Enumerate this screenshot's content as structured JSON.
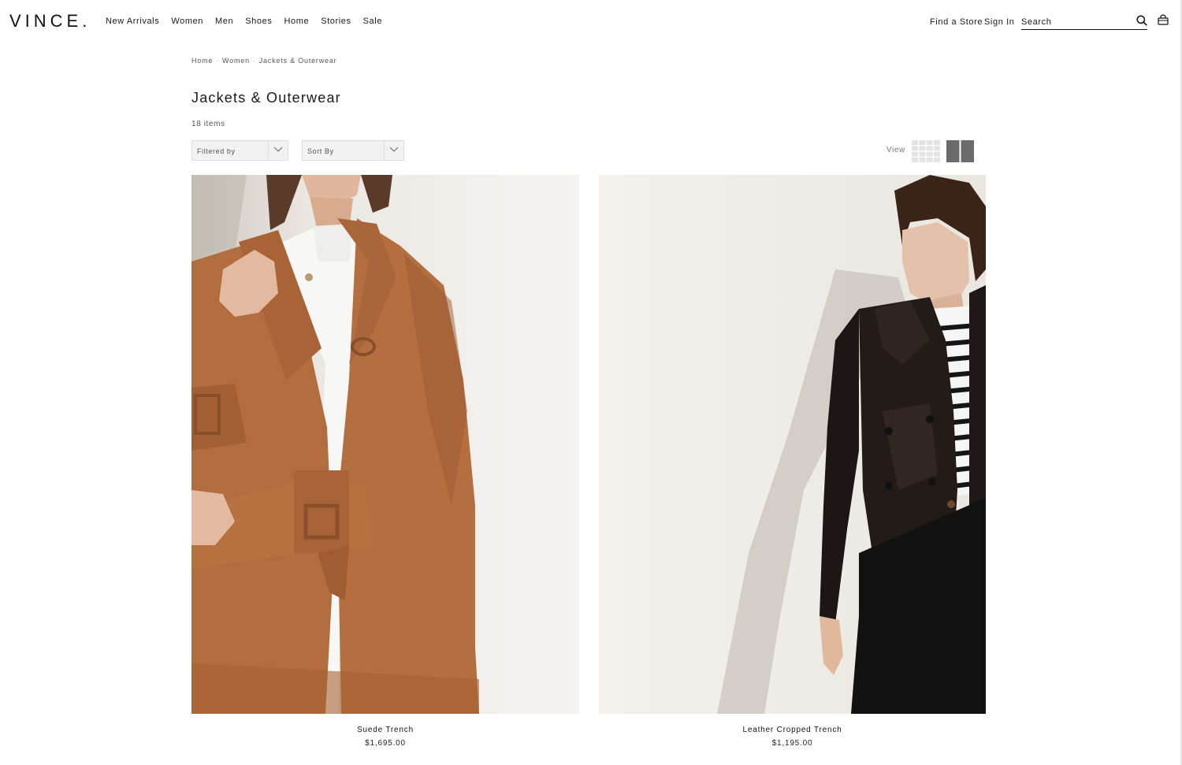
{
  "brand": {
    "logo_text": "VINCE."
  },
  "nav": {
    "items": [
      "New Arrivals",
      "Women",
      "Men",
      "Shoes",
      "Home",
      "Stories",
      "Sale"
    ]
  },
  "utility": {
    "find_store": "Find a Store",
    "sign_in": "Sign In",
    "search_placeholder": "Search",
    "search_icon": "search-icon",
    "bag_icon": "shopping-bag-icon"
  },
  "breadcrumb": [
    "Home",
    "Women",
    "Jackets & Outerwear"
  ],
  "page": {
    "title": "Jackets & Outerwear",
    "item_count": "18 items"
  },
  "controls": {
    "filter_label": "Filtered by",
    "sort_label": "Sort By",
    "view_label": "View",
    "view_options": [
      "grid-4-icon",
      "grid-2-icon"
    ],
    "active_view": "grid-2"
  },
  "products": [
    {
      "name": "Suede Trench",
      "price": "$1,695.00",
      "image": "model in tan suede trench coat over white shirt"
    },
    {
      "name": "Leather Cropped Trench",
      "price": "$1,195.00",
      "image": "model in black leather cropped trench with striped top"
    }
  ],
  "colors": {
    "text": "#1a1a1a",
    "coat_tan": "#b06a3a",
    "coat_black": "#1c1816"
  }
}
